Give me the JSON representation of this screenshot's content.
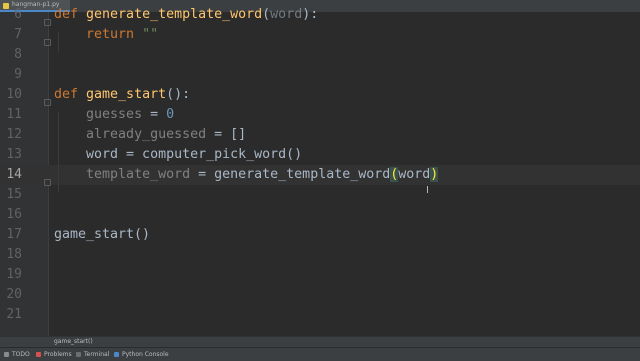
{
  "tab": {
    "filename": "hangman-p1.py"
  },
  "editor": {
    "lines": [
      {
        "number": "6",
        "tokens": [
          {
            "t": "def ",
            "c": "kw"
          },
          {
            "t": "generate_template_word",
            "c": "fn"
          },
          {
            "t": "(",
            "c": ""
          },
          {
            "t": "word",
            "c": "param"
          },
          {
            "t": "):",
            "c": ""
          }
        ]
      },
      {
        "number": "7",
        "tokens": [
          {
            "t": "    ",
            "c": ""
          },
          {
            "t": "return ",
            "c": "kw"
          },
          {
            "t": "\"\"",
            "c": "str"
          }
        ]
      },
      {
        "number": "8",
        "tokens": []
      },
      {
        "number": "9",
        "tokens": []
      },
      {
        "number": "10",
        "tokens": [
          {
            "t": "def ",
            "c": "kw"
          },
          {
            "t": "game_start",
            "c": "fn"
          },
          {
            "t": "():",
            "c": ""
          }
        ]
      },
      {
        "number": "11",
        "tokens": [
          {
            "t": "    ",
            "c": ""
          },
          {
            "t": "guesses",
            "c": "dim"
          },
          {
            "t": " = ",
            "c": ""
          },
          {
            "t": "0",
            "c": "num"
          }
        ]
      },
      {
        "number": "12",
        "tokens": [
          {
            "t": "    ",
            "c": ""
          },
          {
            "t": "already_guessed",
            "c": "dim"
          },
          {
            "t": " = []",
            "c": ""
          }
        ]
      },
      {
        "number": "13",
        "tokens": [
          {
            "t": "    word = computer_pick_word()",
            "c": ""
          }
        ]
      },
      {
        "number": "14",
        "tokens": [
          {
            "t": "    ",
            "c": ""
          },
          {
            "t": "template_word",
            "c": "dim"
          },
          {
            "t": " = generate_template_word",
            "c": ""
          },
          {
            "t": "(",
            "c": "brace-match"
          },
          {
            "t": "word",
            "c": ""
          },
          {
            "t": ")",
            "c": "brace-match"
          }
        ]
      },
      {
        "number": "15",
        "tokens": []
      },
      {
        "number": "16",
        "tokens": []
      },
      {
        "number": "17",
        "tokens": [
          {
            "t": "game_start()",
            "c": ""
          }
        ]
      },
      {
        "number": "18",
        "tokens": []
      },
      {
        "number": "19",
        "tokens": []
      },
      {
        "number": "20",
        "tokens": []
      },
      {
        "number": "21",
        "tokens": []
      }
    ],
    "current_line": "14"
  },
  "breadcrumb": {
    "label": "game_start()"
  },
  "statusbar": {
    "tools": [
      {
        "label": "TODO",
        "icon": "todo-icon",
        "color": "#8a8a8a"
      },
      {
        "label": "Problems",
        "icon": "problems-icon",
        "color": "#d25252"
      },
      {
        "label": "Terminal",
        "icon": "terminal-icon",
        "color": "#6e6e6e"
      },
      {
        "label": "Python Console",
        "icon": "python-icon",
        "color": "#4a88c7"
      }
    ]
  },
  "colors": {
    "background": "#2b2b2b",
    "keyword": "#cc7832",
    "function": "#ffc66d",
    "string": "#6a8759",
    "number": "#6897bb"
  }
}
